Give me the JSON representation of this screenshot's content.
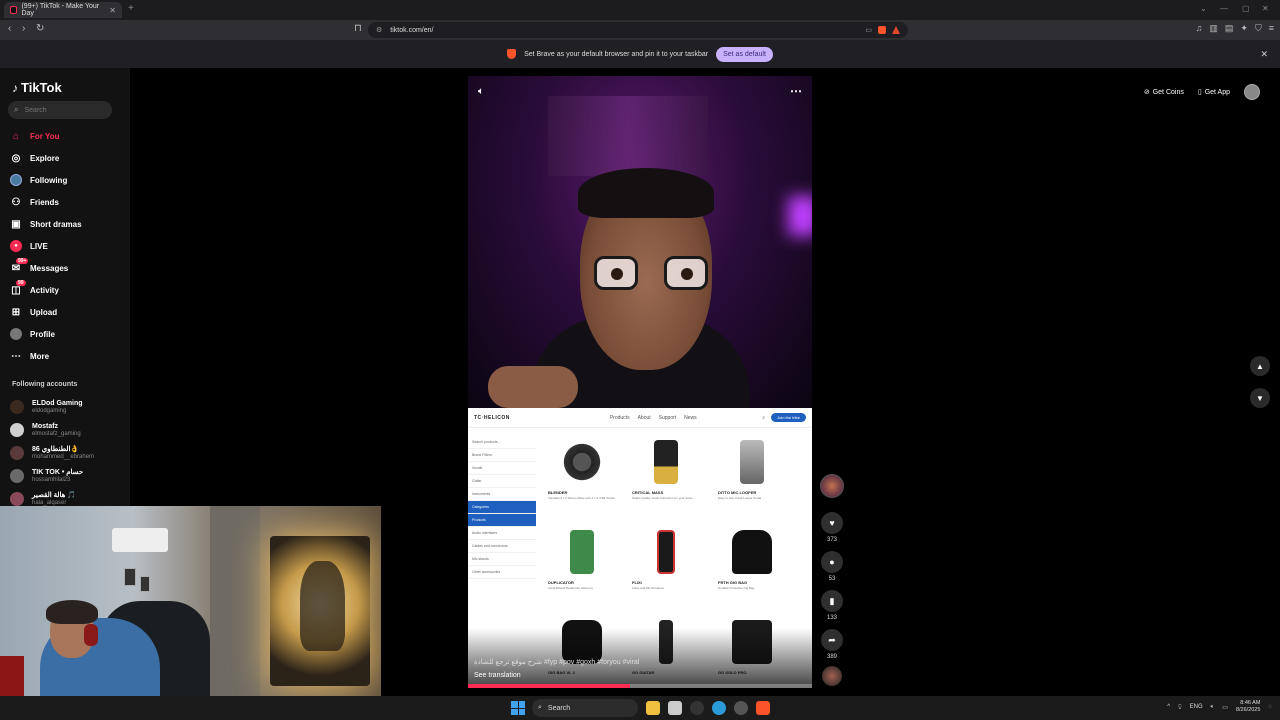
{
  "browser": {
    "tab_title": "(99+) TikTok - Make Your Day",
    "url": "tiktok.com/en/",
    "notice_text": "Set Brave as your default browser and pin it to your taskbar",
    "set_default_label": "Set as default",
    "accent_color": "#fe2c55"
  },
  "sidebar": {
    "logo": "TikTok",
    "search_placeholder": "Search",
    "nav": [
      {
        "label": "For You",
        "icon": "home-icon"
      },
      {
        "label": "Explore",
        "icon": "compass-icon"
      },
      {
        "label": "Following",
        "icon": "following-avatar-icon"
      },
      {
        "label": "Friends",
        "icon": "friends-icon"
      },
      {
        "label": "Short dramas",
        "icon": "short-dramas-icon"
      },
      {
        "label": "LIVE",
        "icon": "live-icon"
      },
      {
        "label": "Messages",
        "icon": "messages-icon",
        "badge": "99+"
      },
      {
        "label": "Activity",
        "icon": "activity-icon",
        "badge": "99"
      },
      {
        "label": "Upload",
        "icon": "upload-icon"
      },
      {
        "label": "Profile",
        "icon": "profile-icon"
      },
      {
        "label": "More",
        "icon": "more-icon"
      }
    ],
    "following_title": "Following accounts",
    "accounts": [
      {
        "name": "ELDod Gaming",
        "handle": "eldodgaming"
      },
      {
        "name": "Mostafz",
        "handle": "elmostafz_gaming"
      },
      {
        "name": "الطنطاوي 86👌",
        "handle": "mohammed__ebrahem"
      },
      {
        "name": "TIK TOK • حسام",
        "handle": "hossamhilal23"
      },
      {
        "name": "هالة القصير 🎵",
        "handle": "hala_alqaser"
      }
    ]
  },
  "video": {
    "caption": "شرح موقع ترجع للشادة #fyp #pov #goxh #foryou #viral",
    "see_translation": "See translation",
    "progress": 0.47,
    "likes": "373",
    "comments": "53",
    "saves": "133",
    "shares": "389"
  },
  "site": {
    "logo": "TC·HELICON",
    "links": [
      "Products",
      "About",
      "Support",
      "News"
    ],
    "join": "Join the tribe",
    "side_rows": [
      "Search products...",
      "Brand Filters",
      "Vocals",
      "Guitar",
      "Instruments",
      "Categories",
      "Products",
      "Audio interfaces",
      "Cables and connectors",
      "Mic stands",
      "Other accessories"
    ],
    "products": [
      {
        "name": "BLENDER",
        "desc": "Versatile 4 x 2 Stereo Mixer with 4 x 2 USB Output"
      },
      {
        "name": "CRITICAL MASS",
        "desc": "Studio Quality Vocal Correction for your Voice"
      },
      {
        "name": "DITTO MIC LOOPER",
        "desc": "Easy to Use Vocal Looper Pedal"
      },
      {
        "name": "DUPLICATOR",
        "desc": "Vocal Effects Pedal with Harmony"
      },
      {
        "name": "FLIXI",
        "desc": "Voice and Mic Enhancer"
      },
      {
        "name": "FRTH GIG BAG",
        "desc": "Durable Protective Gig Bag"
      },
      {
        "name": "GIG BAG VL 2",
        "desc": ""
      },
      {
        "name": "GO GUITAR",
        "desc": ""
      },
      {
        "name": "GO SOLO PRO",
        "desc": ""
      }
    ]
  },
  "topright": {
    "get_coins": "Get Coins",
    "get_app": "Get App"
  },
  "taskbar": {
    "search": "Search",
    "lang": "ENG",
    "time": "8:46 AM",
    "date": "8/26/2025"
  }
}
